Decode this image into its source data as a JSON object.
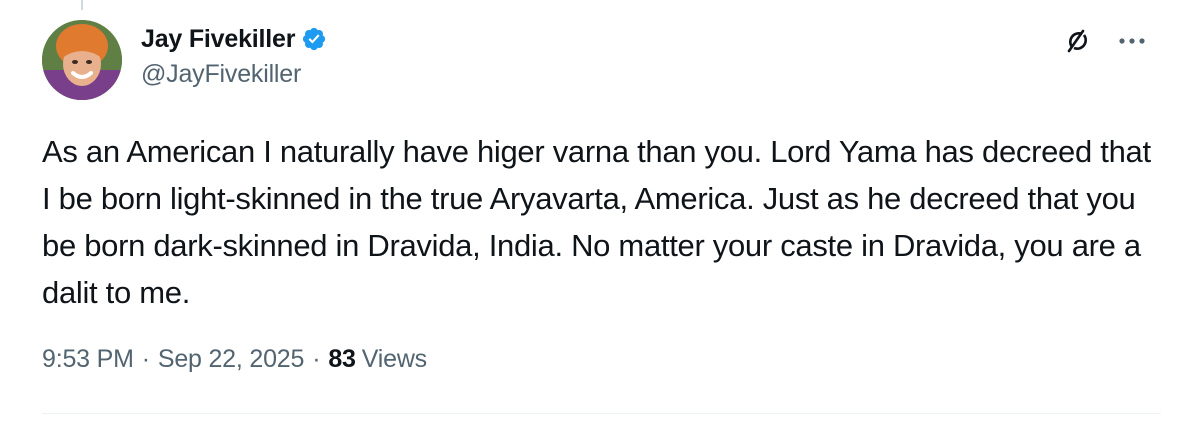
{
  "author": {
    "display_name": "Jay Fivekiller",
    "handle": "@JayFivekiller",
    "verified": true,
    "verified_color": "#1d9bf0"
  },
  "icons": {
    "verified": "verified-badge-icon",
    "grok": "grok-icon",
    "more": "more-options-icon"
  },
  "tweet": {
    "text": "As an American I naturally have higer varna than you. Lord Yama has decreed that I be born light-skinned in the true Aryavarta, America. Just as he decreed that you be born dark-skinned in Dravida, India. No matter your caste in Dravida, you are a dalit to me.",
    "time": "9:53 PM",
    "date": "Sep 22, 2025",
    "views_count": "83",
    "views_label": "Views"
  },
  "colors": {
    "primary_text": "#0f1419",
    "secondary_text": "#536471",
    "divider": "#eff3f4"
  }
}
